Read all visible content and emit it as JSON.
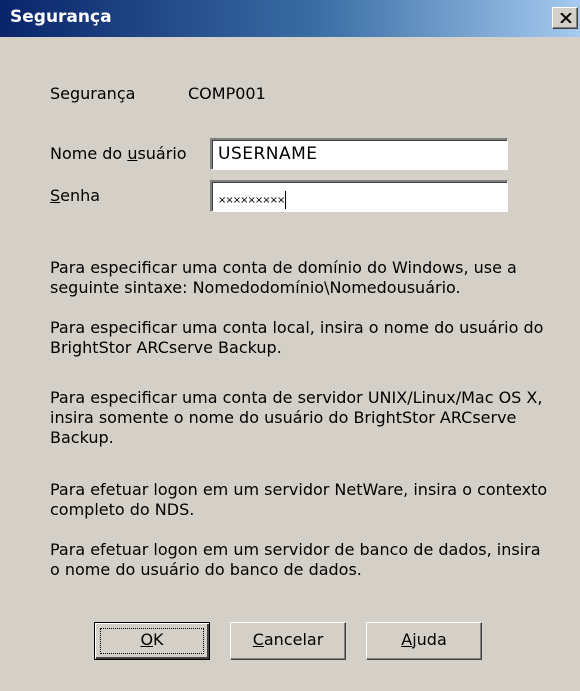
{
  "window": {
    "title": "Segurança",
    "close_icon": "close-icon"
  },
  "security": {
    "label": "Segurança",
    "value": "COMP001"
  },
  "username": {
    "label_pre": "Nome do ",
    "label_accel": "u",
    "label_post": "suário",
    "value": "USERNAME"
  },
  "password": {
    "label_accel": "S",
    "label_post": "enha",
    "value": "×××××××××"
  },
  "help_text": [
    "Para especificar uma conta de domínio do Windows, use a seguinte sintaxe: Nomedodomínio\\Nomedousuário.",
    "Para especificar uma conta local, insira o nome do usuário do BrightStor ARCserve Backup.",
    "Para especificar uma conta de servidor UNIX/Linux/Mac OS X, insira somente o nome do usuário do BrightStor ARCserve Backup.",
    "Para efetuar logon em um servidor NetWare, insira o contexto completo do NDS.",
    "Para efetuar logon em um servidor de banco de dados, insira o nome do usuário do banco de dados."
  ],
  "buttons": {
    "ok": {
      "accel": "O",
      "rest": "K"
    },
    "cancel": {
      "accel": "C",
      "rest": "ancelar"
    },
    "help": {
      "accel": "A",
      "rest": "juda"
    }
  }
}
